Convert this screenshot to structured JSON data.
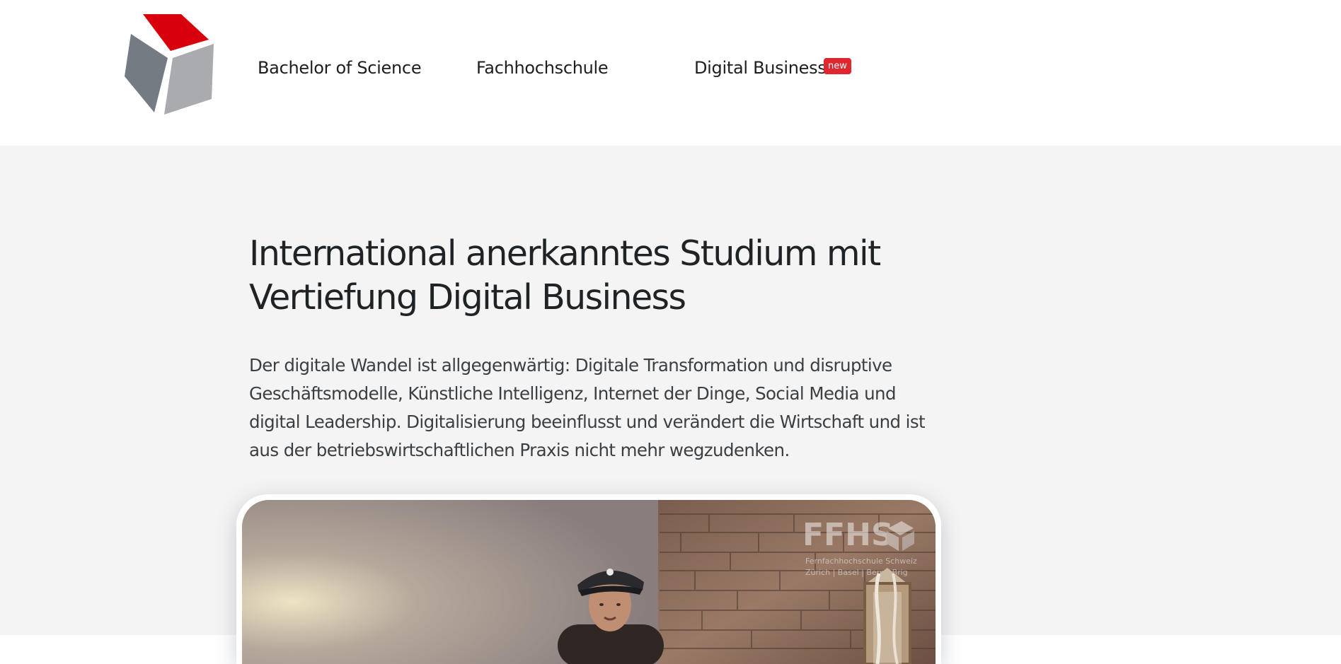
{
  "header": {
    "logo_name": "cube-logo",
    "nav": [
      {
        "label": "Bachelor of Science"
      },
      {
        "label": "Fachhochschule"
      },
      {
        "label": "Digital Business",
        "badge": "new"
      }
    ]
  },
  "hero": {
    "title": "International anerkanntes Studium mit Vertiefung Digital Business",
    "body": "Der digitale Wandel ist allgegenwärtig: Digitale Transformation und disruptive Geschäftsmodelle, Künstliche Intelligenz, Internet der Dinge, Social Media und digital Leadership. Digitalisierung beeinflusst und verändert die Wirtschaft und ist aus der betriebswirtschaftlichen Praxis nicht mehr wegzudenken."
  },
  "video": {
    "watermark_title": "FFHS",
    "watermark_subtitle": "Fernfachhochschule Schweiz",
    "watermark_locations": "Zürich | Basel | Bern | Brig"
  },
  "colors": {
    "accent": "#e0262e",
    "hero_bg": "#f4f4f4",
    "text": "#1f2326",
    "logo_red": "#d9000d",
    "logo_gray_dark": "#747b82",
    "logo_gray_light": "#a9abaf"
  }
}
